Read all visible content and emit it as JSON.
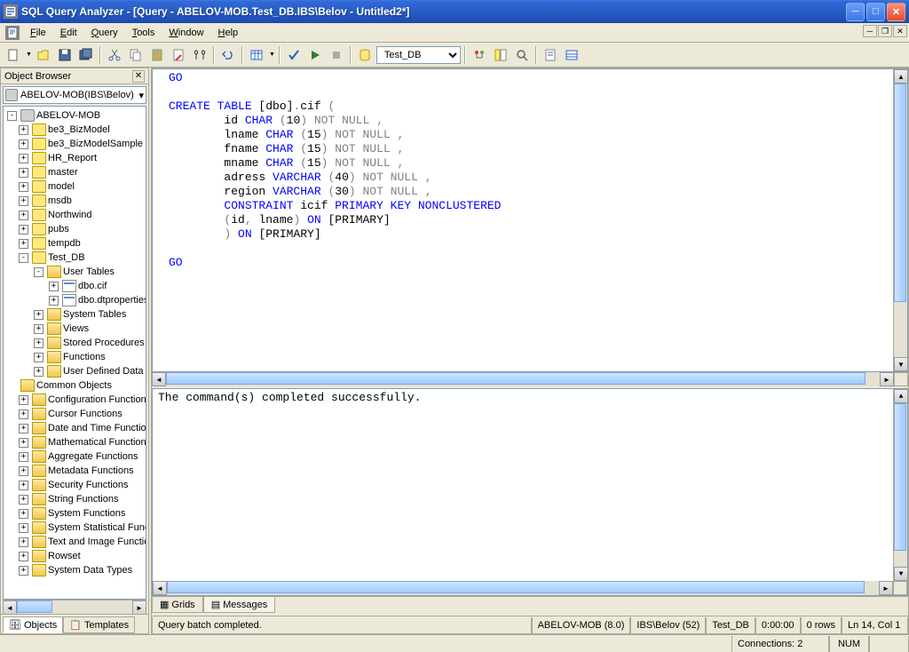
{
  "title": "SQL Query Analyzer - [Query - ABELOV-MOB.Test_DB.IBS\\Belov - Untitled2*]",
  "menubar": [
    "File",
    "Edit",
    "Query",
    "Tools",
    "Window",
    "Help"
  ],
  "toolbar": {
    "db_selected": "Test_DB"
  },
  "object_browser": {
    "title": "Object Browser",
    "combo": "ABELOV-MOB(IBS\\Belov)",
    "root": "ABELOV-MOB",
    "databases": [
      "be3_BizModel",
      "be3_BizModelSample",
      "HR_Report",
      "master",
      "model",
      "msdb",
      "Northwind",
      "pubs",
      "tempdb"
    ],
    "open_db": "Test_DB",
    "open_db_children": {
      "user_tables": "User Tables",
      "tables": [
        "dbo.cif",
        "dbo.dtproperties"
      ],
      "others": [
        "System Tables",
        "Views",
        "Stored Procedures",
        "Functions",
        "User Defined Data Types"
      ]
    },
    "common_objects": "Common Objects",
    "common_children": [
      "Configuration Functions",
      "Cursor Functions",
      "Date and Time Functions",
      "Mathematical Functions",
      "Aggregate Functions",
      "Metadata Functions",
      "Security Functions",
      "String Functions",
      "System Functions",
      "System Statistical Functions",
      "Text and Image Functions",
      "Rowset",
      "System Data Types"
    ],
    "tabs": [
      "Objects",
      "Templates"
    ]
  },
  "editor_lines": [
    {
      "t": "GO",
      "cls": "kw",
      "indent": 0
    },
    {
      "t": "",
      "cls": "",
      "indent": 0
    },
    {
      "parts": [
        {
          "t": "CREATE TABLE",
          "c": "kw"
        },
        {
          "t": " [dbo]",
          "c": ""
        },
        {
          "t": ".",
          "c": "gy"
        },
        {
          "t": "cif ",
          "c": ""
        },
        {
          "t": "(",
          "c": "gy"
        }
      ],
      "indent": 0
    },
    {
      "parts": [
        {
          "t": "        id ",
          "c": ""
        },
        {
          "t": "CHAR ",
          "c": "kw"
        },
        {
          "t": "(",
          "c": "gy"
        },
        {
          "t": "10",
          "c": ""
        },
        {
          "t": ") ",
          "c": "gy"
        },
        {
          "t": "NOT NULL ",
          "c": "gy"
        },
        {
          "t": ",",
          "c": "gy"
        }
      ],
      "indent": 0
    },
    {
      "parts": [
        {
          "t": "        lname ",
          "c": ""
        },
        {
          "t": "CHAR ",
          "c": "kw"
        },
        {
          "t": "(",
          "c": "gy"
        },
        {
          "t": "15",
          "c": ""
        },
        {
          "t": ") ",
          "c": "gy"
        },
        {
          "t": "NOT NULL ",
          "c": "gy"
        },
        {
          "t": ",",
          "c": "gy"
        }
      ],
      "indent": 0
    },
    {
      "parts": [
        {
          "t": "        fname ",
          "c": ""
        },
        {
          "t": "CHAR ",
          "c": "kw"
        },
        {
          "t": "(",
          "c": "gy"
        },
        {
          "t": "15",
          "c": ""
        },
        {
          "t": ") ",
          "c": "gy"
        },
        {
          "t": "NOT NULL ",
          "c": "gy"
        },
        {
          "t": ",",
          "c": "gy"
        }
      ],
      "indent": 0
    },
    {
      "parts": [
        {
          "t": "        mname ",
          "c": ""
        },
        {
          "t": "CHAR ",
          "c": "kw"
        },
        {
          "t": "(",
          "c": "gy"
        },
        {
          "t": "15",
          "c": ""
        },
        {
          "t": ") ",
          "c": "gy"
        },
        {
          "t": "NOT NULL ",
          "c": "gy"
        },
        {
          "t": ",",
          "c": "gy"
        }
      ],
      "indent": 0
    },
    {
      "parts": [
        {
          "t": "        adress ",
          "c": ""
        },
        {
          "t": "VARCHAR ",
          "c": "kw"
        },
        {
          "t": "(",
          "c": "gy"
        },
        {
          "t": "40",
          "c": ""
        },
        {
          "t": ") ",
          "c": "gy"
        },
        {
          "t": "NOT NULL ",
          "c": "gy"
        },
        {
          "t": ",",
          "c": "gy"
        }
      ],
      "indent": 0
    },
    {
      "parts": [
        {
          "t": "        region ",
          "c": ""
        },
        {
          "t": "VARCHAR ",
          "c": "kw"
        },
        {
          "t": "(",
          "c": "gy"
        },
        {
          "t": "30",
          "c": ""
        },
        {
          "t": ") ",
          "c": "gy"
        },
        {
          "t": "NOT NULL ",
          "c": "gy"
        },
        {
          "t": ",",
          "c": "gy"
        }
      ],
      "indent": 0
    },
    {
      "parts": [
        {
          "t": "        ",
          "c": ""
        },
        {
          "t": "CONSTRAINT",
          "c": "kw"
        },
        {
          "t": " icif ",
          "c": ""
        },
        {
          "t": "PRIMARY KEY NONCLUSTERED",
          "c": "kw"
        }
      ],
      "indent": 0
    },
    {
      "parts": [
        {
          "t": "        ",
          "c": ""
        },
        {
          "t": "(",
          "c": "gy"
        },
        {
          "t": "id",
          "c": ""
        },
        {
          "t": ",",
          "c": "gy"
        },
        {
          "t": " lname",
          "c": ""
        },
        {
          "t": ") ",
          "c": "gy"
        },
        {
          "t": "ON",
          "c": "kw"
        },
        {
          "t": " [PRIMARY]",
          "c": ""
        }
      ],
      "indent": 0
    },
    {
      "parts": [
        {
          "t": "        ",
          "c": ""
        },
        {
          "t": ") ",
          "c": "gy"
        },
        {
          "t": "ON",
          "c": "kw"
        },
        {
          "t": " [PRIMARY]",
          "c": ""
        }
      ],
      "indent": 0
    },
    {
      "t": "",
      "cls": "",
      "indent": 0
    },
    {
      "t": "GO",
      "cls": "kw",
      "indent": 0
    }
  ],
  "results": {
    "message": "The command(s) completed successfully.",
    "tabs": [
      "Grids",
      "Messages"
    ]
  },
  "statusbar1": {
    "msg": "Query batch completed.",
    "server": "ABELOV-MOB (8.0)",
    "user": "IBS\\Belov (52)",
    "db": "Test_DB",
    "time": "0:00:00",
    "rows": "0 rows",
    "pos": "Ln 14, Col 1"
  },
  "statusbar2": {
    "conn": "Connections: 2",
    "num": "NUM"
  }
}
